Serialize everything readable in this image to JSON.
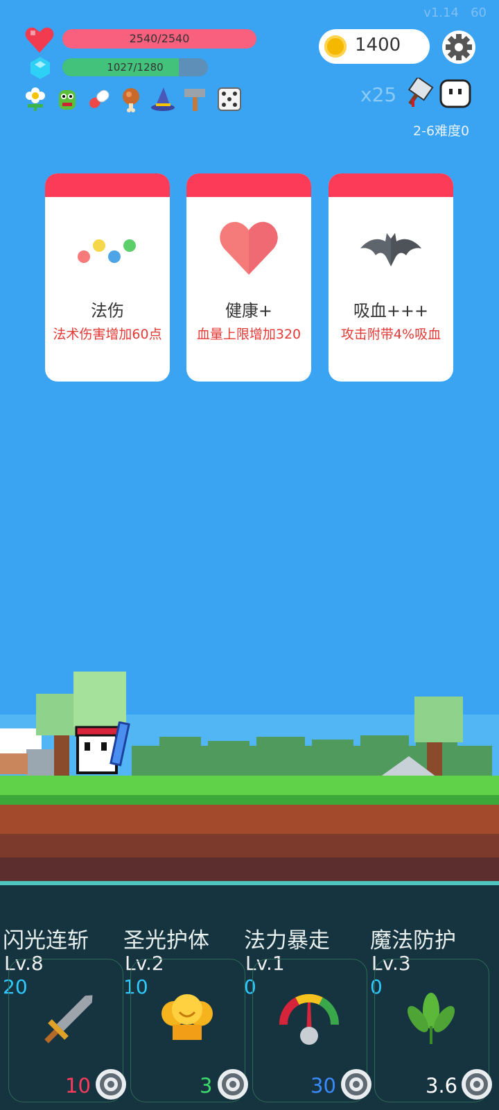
{
  "meta": {
    "version": "v1.14",
    "fps": "60"
  },
  "stats": {
    "hp_text": "2540/2540",
    "hp_fraction": 1.0,
    "hp_color": "#f9607d",
    "mp_text": "1027/1280",
    "mp_fraction": 0.8,
    "mp_color": "#43c27b"
  },
  "currency": {
    "coins": "1400"
  },
  "items": [
    "flower-icon",
    "green-monster-icon",
    "pill-capsule-icon",
    "meat-leg-icon",
    "wizard-hat-icon",
    "hammer-icon",
    "dice-icon"
  ],
  "enemy": {
    "count": "x25",
    "stage": "2-6难度0"
  },
  "cards": [
    {
      "icon": "color-dots-icon",
      "title": "法伤",
      "desc": "法术伤害增加60点"
    },
    {
      "icon": "heart-icon",
      "title": "健康+",
      "desc": "血量上限增加320"
    },
    {
      "icon": "bat-icon",
      "title": "吸血+++",
      "desc": "攻击附带4%吸血"
    }
  ],
  "skills": [
    {
      "name": "闪光连斩",
      "level": "Lv.8",
      "count": "20",
      "cost": "10",
      "cost_color": "#ff3b5c",
      "icon": "sword-icon"
    },
    {
      "name": "圣光护体",
      "level": "Lv.2",
      "count": "10",
      "cost": "3",
      "cost_color": "#3ddc6c",
      "icon": "golden-trophy-icon"
    },
    {
      "name": "法力暴走",
      "level": "Lv.1",
      "count": "0",
      "cost": "30",
      "cost_color": "#3a8bff",
      "icon": "gauge-icon"
    },
    {
      "name": "魔法防护",
      "level": "Lv.3",
      "count": "0",
      "cost": "3.6",
      "cost_color": "#ffffff",
      "icon": "leaf-plant-icon"
    }
  ]
}
